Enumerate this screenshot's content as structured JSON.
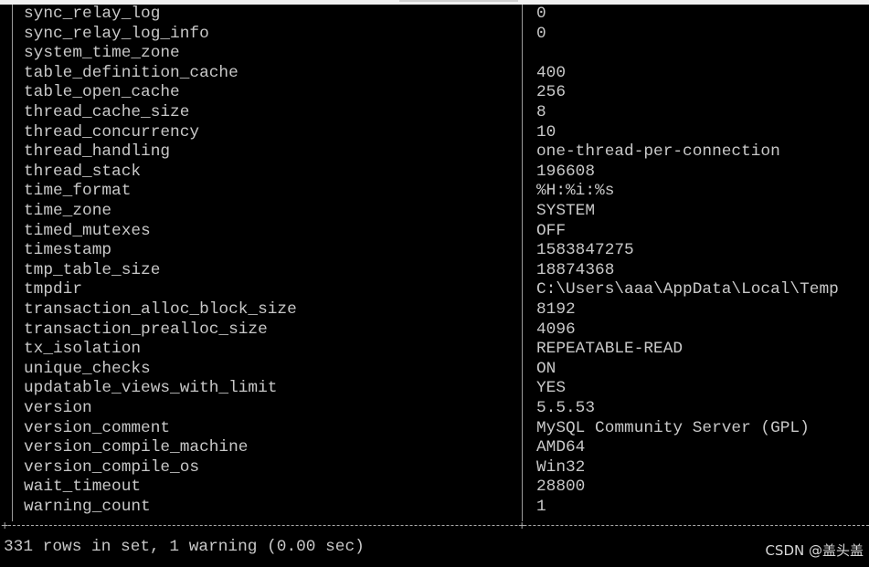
{
  "rows": [
    {
      "name": "sync_relay_log",
      "value": "0"
    },
    {
      "name": "sync_relay_log_info",
      "value": "0"
    },
    {
      "name": "system_time_zone",
      "value": ""
    },
    {
      "name": "table_definition_cache",
      "value": "400"
    },
    {
      "name": "table_open_cache",
      "value": "256"
    },
    {
      "name": "thread_cache_size",
      "value": "8"
    },
    {
      "name": "thread_concurrency",
      "value": "10"
    },
    {
      "name": "thread_handling",
      "value": "one-thread-per-connection"
    },
    {
      "name": "thread_stack",
      "value": "196608"
    },
    {
      "name": "time_format",
      "value": "%H:%i:%s"
    },
    {
      "name": "time_zone",
      "value": "SYSTEM"
    },
    {
      "name": "timed_mutexes",
      "value": "OFF"
    },
    {
      "name": "timestamp",
      "value": "1583847275"
    },
    {
      "name": "tmp_table_size",
      "value": "18874368"
    },
    {
      "name": "tmpdir",
      "value": "C:\\Users\\aaa\\AppData\\Local\\Temp"
    },
    {
      "name": "transaction_alloc_block_size",
      "value": "8192"
    },
    {
      "name": "transaction_prealloc_size",
      "value": "4096"
    },
    {
      "name": "tx_isolation",
      "value": "REPEATABLE-READ"
    },
    {
      "name": "unique_checks",
      "value": "ON"
    },
    {
      "name": "updatable_views_with_limit",
      "value": "YES"
    },
    {
      "name": "version",
      "value": "5.5.53"
    },
    {
      "name": "version_comment",
      "value": "MySQL Community Server (GPL)"
    },
    {
      "name": "version_compile_machine",
      "value": "AMD64"
    },
    {
      "name": "version_compile_os",
      "value": "Win32"
    },
    {
      "name": "wait_timeout",
      "value": "28800"
    },
    {
      "name": "warning_count",
      "value": "1"
    }
  ],
  "footer": "331 rows in set, 1 warning (0.00 sec)",
  "watermark": "CSDN @盖头盖"
}
